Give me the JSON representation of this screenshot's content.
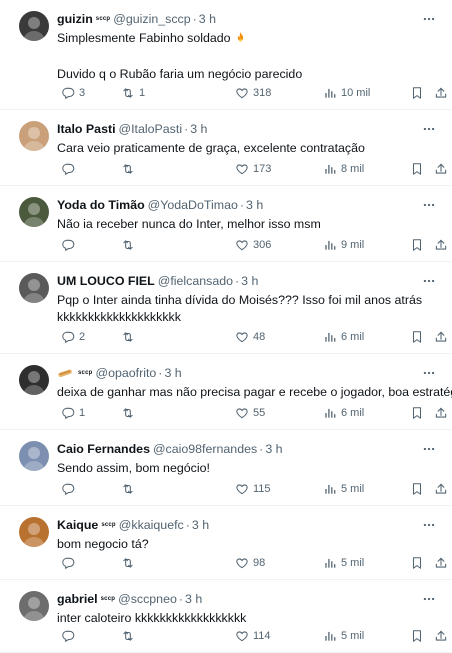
{
  "tweets": [
    {
      "name": "guizin",
      "badge": "sccp",
      "handle": "@guizin_sccp",
      "time": "3 h",
      "lines": [
        "Simplesmente Fabinho soldado",
        "",
        "Duvido q o Rubão faria um negócio parecido"
      ],
      "emoji": "fire-emoji",
      "replies": "3",
      "retweets": "1",
      "likes": "318",
      "views": "10 mil",
      "avatar_color": "#3a3a3a"
    },
    {
      "name": "Italo Pasti",
      "badge": "",
      "handle": "@ItaloPasti",
      "time": "3 h",
      "lines": [
        "Cara veio praticamente de graça, excelente contratação"
      ],
      "replies": "",
      "retweets": "",
      "likes": "173",
      "views": "8 mil",
      "avatar_color": "#c9a07a"
    },
    {
      "name": "Yoda do Timão",
      "badge": "",
      "handle": "@YodaDoTimao",
      "time": "3 h",
      "lines": [
        "Não ia receber nunca do Inter, melhor isso msm"
      ],
      "replies": "",
      "retweets": "",
      "likes": "306",
      "views": "9 mil",
      "avatar_color": "#4b5a3c"
    },
    {
      "name": "UM LOUCO FIEL",
      "badge": "",
      "handle": "@fielcansado",
      "time": "3 h",
      "lines": [
        "Pqp o Inter ainda tinha dívida do Moisés??? Isso foi mil anos atrás",
        "kkkkkkkkkkkkkkkkkkkk"
      ],
      "replies": "2",
      "retweets": "",
      "likes": "48",
      "views": "6 mil",
      "avatar_color": "#5a5a5a"
    },
    {
      "name": "",
      "badge": "sccp",
      "handle": "@opaofrito",
      "time": "3 h",
      "lines": [
        "deixa de ganhar mas não precisa pagar e recebe o jogador, boa estratégia ."
      ],
      "name_emoji": "bread-emoji",
      "replies": "1",
      "retweets": "",
      "likes": "55",
      "views": "6 mil",
      "avatar_color": "#2e2e2e"
    },
    {
      "name": "Caio Fernandes",
      "badge": "",
      "handle": "@caio98fernandes",
      "time": "3 h",
      "lines": [
        "Sendo assim, bom negócio!"
      ],
      "replies": "",
      "retweets": "",
      "likes": "115",
      "views": "5 mil",
      "avatar_color": "#7d8fb0"
    },
    {
      "name": "Kaique",
      "badge": "sccp",
      "handle": "@kkaiquefc",
      "time": "3 h",
      "lines": [
        "bom negocio tá?"
      ],
      "replies": "",
      "retweets": "",
      "likes": "98",
      "views": "5 mil",
      "avatar_color": "#b8712f"
    },
    {
      "name": "gabriel",
      "badge": "sccp",
      "handle": "@sccpneo",
      "time": "3 h",
      "lines": [
        "inter caloteiro kkkkkkkkkkkkkkkkkk"
      ],
      "replies": "",
      "retweets": "",
      "likes": "114",
      "views": "5 mil",
      "avatar_color": "#6d6d6d"
    }
  ],
  "colors": {
    "text": "#0f1419",
    "muted": "#536471",
    "divider": "#eff3f4"
  },
  "icons": [
    "more-icon",
    "reply-icon",
    "retweet-icon",
    "like-icon",
    "views-icon",
    "bookmark-icon",
    "share-icon"
  ]
}
